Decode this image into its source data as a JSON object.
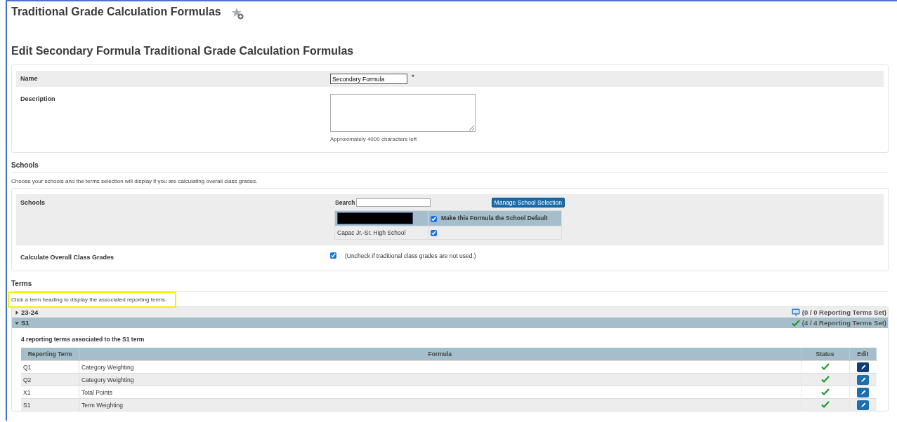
{
  "page_title": "Traditional Grade Calculation Formulas",
  "form_title": "Edit Secondary Formula Traditional Grade Calculation Formulas",
  "general": {
    "name_label": "Name",
    "name_value": "Secondary Formula",
    "required_mark": "*",
    "description_label": "Description",
    "chars_left": "Approximately 4000 characters left"
  },
  "schools_section": {
    "heading": "Schools",
    "hint": "Choose your schools and the terms selection will display if you are calculating overall class grades.",
    "schools_label": "Schools",
    "search_label": "Search",
    "manage_button": "Manage School Selection",
    "default_header": {
      "label": "Make this Formula the School Default",
      "checked": true
    },
    "schools": [
      {
        "name": "Capac Jr.-Sr. High School",
        "default": true
      }
    ],
    "calculate_label": "Calculate Overall Class Grades",
    "calculate": {
      "checked": true,
      "note": "(Uncheck if traditional class grades are not used.)"
    }
  },
  "terms_section": {
    "heading": "Terms",
    "hint": "Click a term heading to display the associated reporting terms.",
    "hint_highlighted": true,
    "terms": [
      {
        "name": "23-24",
        "expanded": false,
        "kind": "info",
        "status": "(0 / 0 Reporting Terms Set)"
      },
      {
        "name": "S1",
        "expanded": true,
        "kind": "check",
        "status": "(4 / 4 Reporting Terms Set)",
        "summary": "4 reporting terms associated to the S1 term",
        "columns": [
          "Reporting Term",
          "Formula",
          "Status",
          "Edit"
        ],
        "rows": [
          {
            "term": "Q1",
            "formula": "Category Weighting",
            "complete": true,
            "active": true
          },
          {
            "term": "Q2",
            "formula": "Category Weighting",
            "complete": true,
            "active": false
          },
          {
            "term": "X1",
            "formula": "Total Points",
            "complete": true,
            "active": false
          },
          {
            "term": "S1",
            "formula": "Term Weighting",
            "complete": true,
            "active": false
          }
        ]
      }
    ]
  }
}
